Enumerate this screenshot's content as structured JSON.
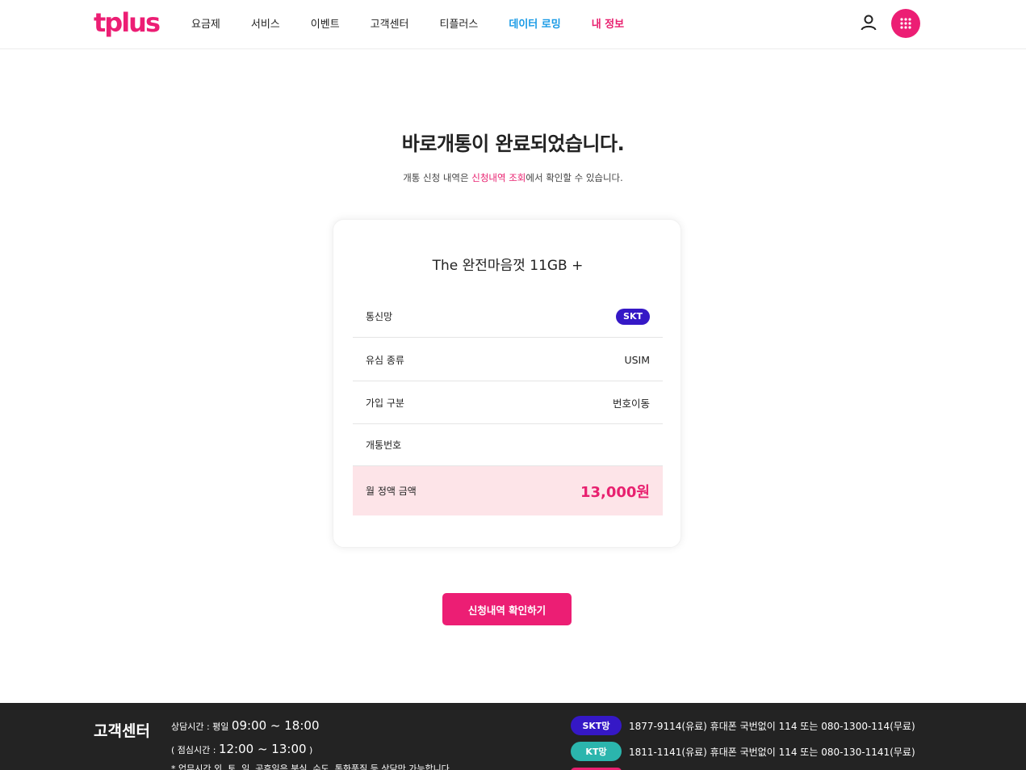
{
  "header": {
    "logo_text": "tplus",
    "nav": [
      "요금제",
      "서비스",
      "이벤트",
      "고객센터",
      "티플러스",
      "데이터 로밍",
      "내 정보"
    ],
    "brand_color": "#ec1e74",
    "roaming_color": "#1a9be6"
  },
  "main": {
    "title": "바로개통이 완료되었습니다.",
    "subtitle_before": "개통 신청 내역은 ",
    "subtitle_link": "신청내역 조회",
    "subtitle_after": "에서 확인할 수 있습니다.",
    "plan_name": "The 완전마음껏 11GB +",
    "rows": [
      {
        "label": "통신망",
        "value": "SKT"
      },
      {
        "label": "유심 종류",
        "value": "USIM"
      },
      {
        "label": "가입 구분",
        "value": "번호이동"
      },
      {
        "label": "개통번호",
        "value": ""
      }
    ],
    "price_label": "월 정액 금액",
    "price_value": "13,000원",
    "cta_label": "신청내역 확인하기"
  },
  "footer": {
    "title": "고객센터",
    "hours_label": "상담시간 : 평일 ",
    "hours_value": "09:00 ~ 18:00",
    "lunch_label": "( 점심시간 : ",
    "lunch_value": "12:00 ~ 13:00",
    "lunch_close": " )",
    "notice": "* 업무시간 외, 토, 일, 공휴일은 분실, 수도, 통화품질 등 상담만 가능합니다.",
    "carriers": [
      {
        "name": "SKT망",
        "info": "1877-9114(유료) 휴대폰 국번없이 114 또는 080-1300-114(무료)",
        "color": "#3518c6"
      },
      {
        "name": "KT망",
        "info": "1811-1141(유료) 휴대폰 국번없이 114 또는 080-130-1141(무료)",
        "color": "#2bb5ad"
      }
    ]
  }
}
